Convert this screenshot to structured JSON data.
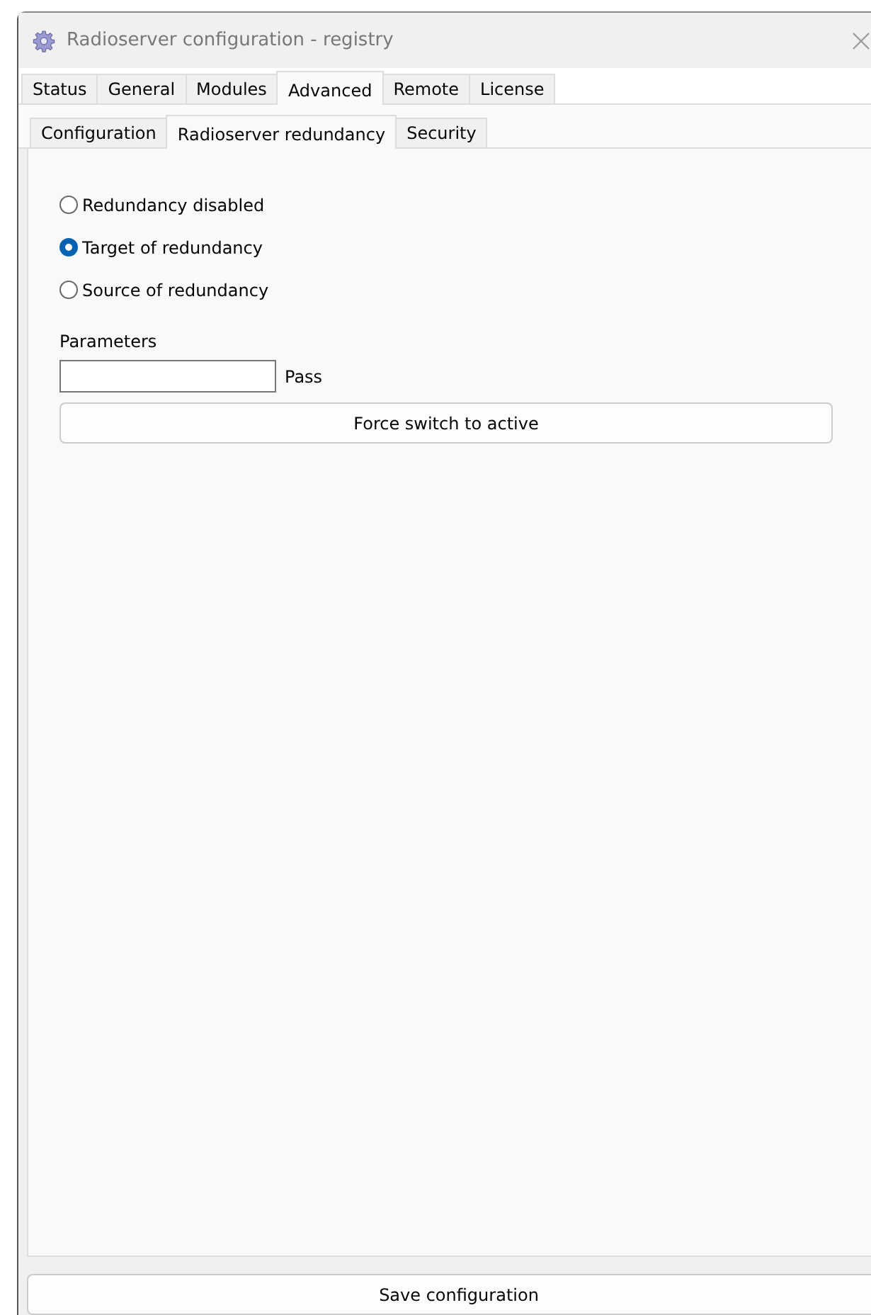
{
  "window": {
    "title": "Radioserver configuration - registry"
  },
  "tabs": [
    {
      "label": "Status",
      "selected": false
    },
    {
      "label": "General",
      "selected": false
    },
    {
      "label": "Modules",
      "selected": false
    },
    {
      "label": "Advanced",
      "selected": true
    },
    {
      "label": "Remote",
      "selected": false
    },
    {
      "label": "License",
      "selected": false
    }
  ],
  "subtabs": [
    {
      "label": "Configuration",
      "selected": false
    },
    {
      "label": "Radioserver redundancy",
      "selected": true
    },
    {
      "label": "Security",
      "selected": false
    }
  ],
  "redundancy_options": [
    {
      "label": "Redundancy disabled",
      "selected": false
    },
    {
      "label": "Target of redundancy",
      "selected": true
    },
    {
      "label": "Source of redundancy",
      "selected": false
    }
  ],
  "parameters": {
    "label": "Parameters",
    "field_label": "Pass"
  },
  "force_button": "Force switch to active",
  "save_button": "Save configuration"
}
